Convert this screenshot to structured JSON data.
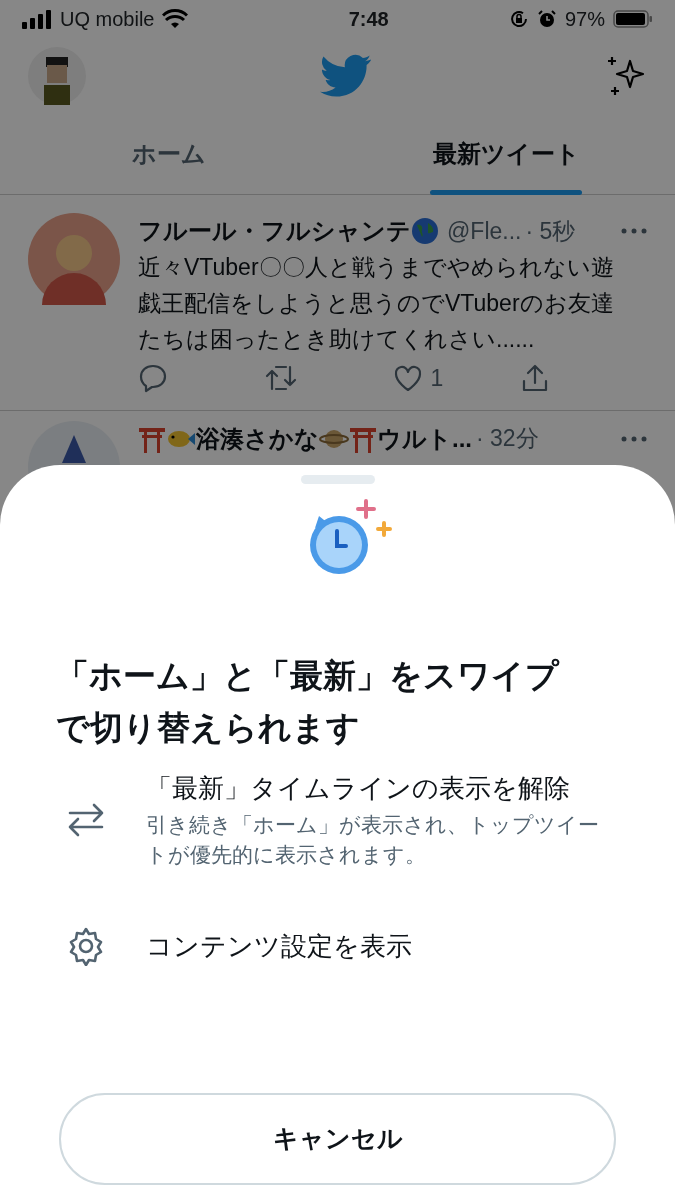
{
  "status_bar": {
    "carrier": "UQ mobile",
    "time": "7:48",
    "battery": "97%"
  },
  "tabs": [
    {
      "label": "ホーム",
      "selected": false
    },
    {
      "label": "最新ツイート",
      "selected": true
    }
  ],
  "tweets": [
    {
      "name": "フルール・フルシャンテ",
      "handle": "@Fle...",
      "time": "· 5秒",
      "text": "近々VTuber〇〇人と戦うまでやめられない遊戯王配信をしようと思うのでVTuberのお友達たちは困ったとき助けてくれさい......",
      "like_count": "1"
    },
    {
      "name": "浴湊さかな",
      "name_tail": "ウルト...",
      "time": "· 32分"
    }
  ],
  "sheet": {
    "title": "「ホーム」と「最新」をスワイプで切り替えられます",
    "options": [
      {
        "kind": "swap",
        "label": "「最新」タイムラインの表示を解除",
        "description": "引き続き「ホーム」が表示され、トップツイートが優先的に表示されます。"
      },
      {
        "kind": "settings",
        "label": "コンテンツ設定を表示"
      }
    ],
    "cancel": "キャンセル"
  }
}
